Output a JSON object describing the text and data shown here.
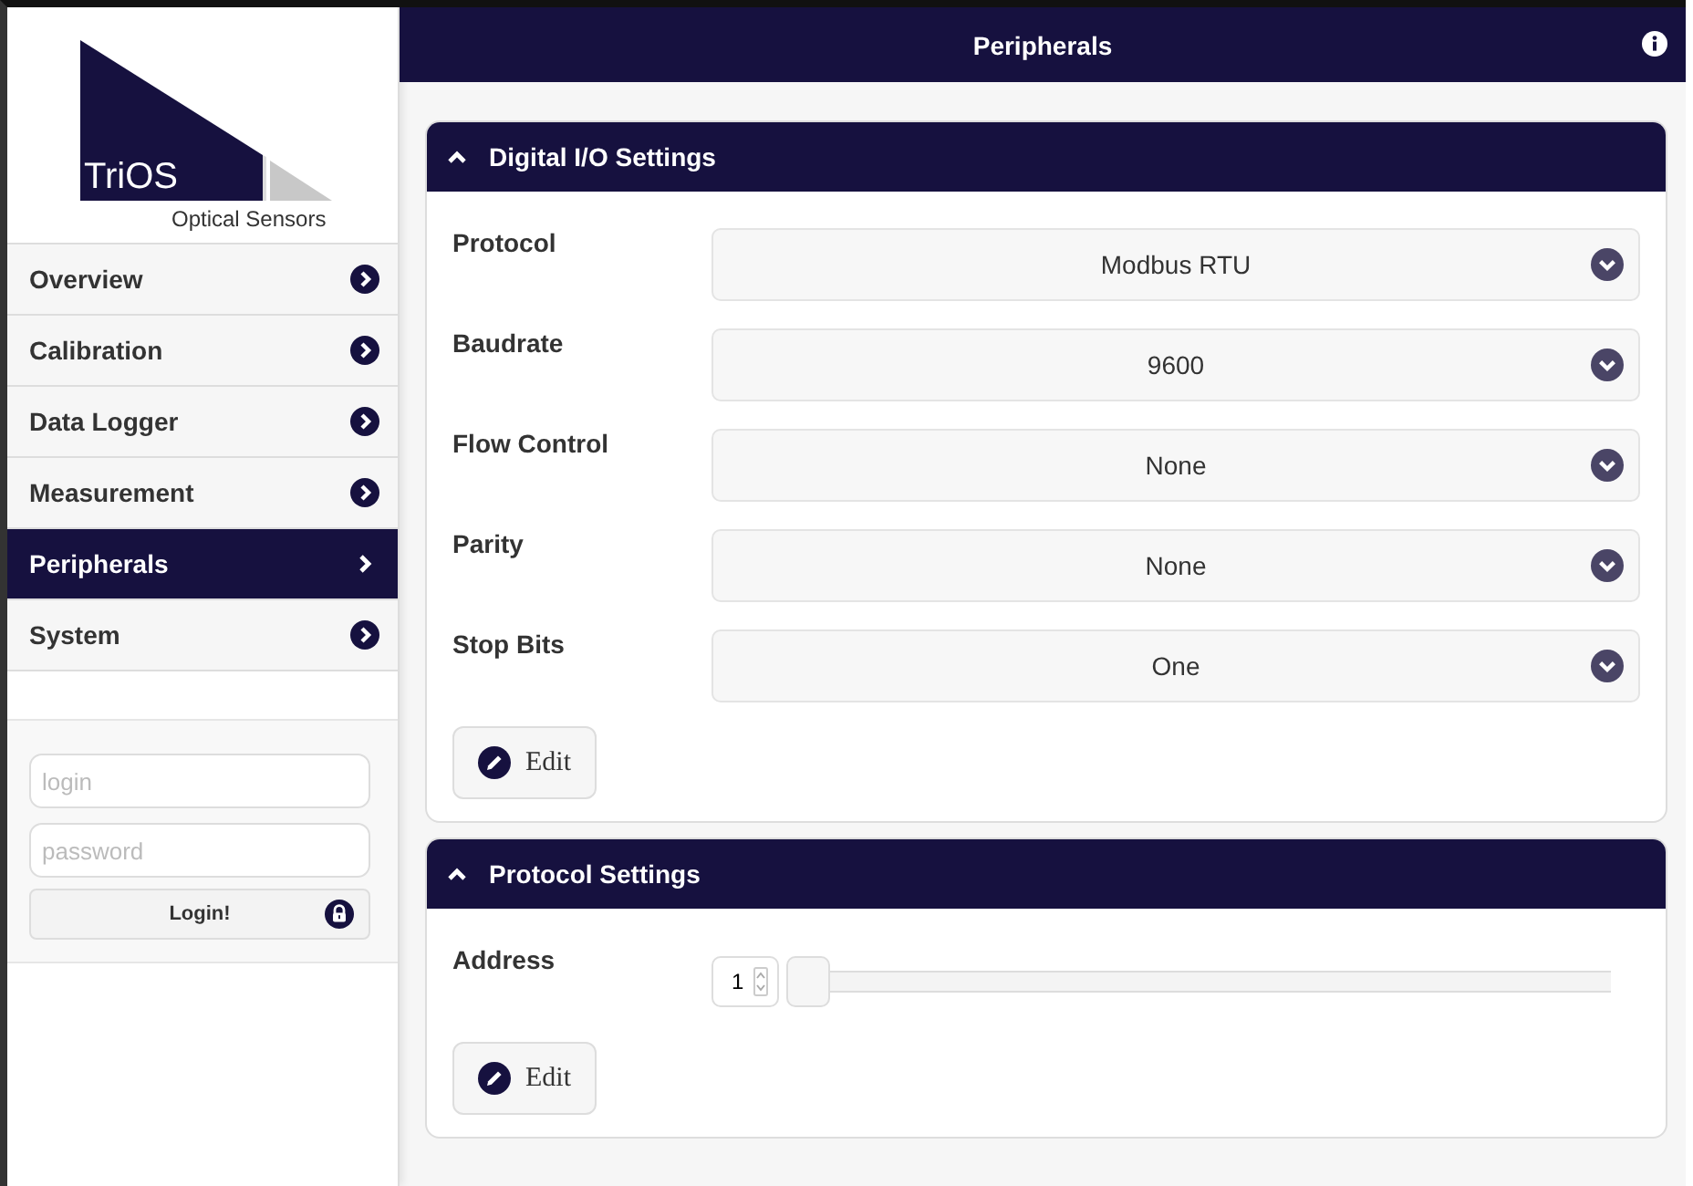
{
  "logo": {
    "brand": "TriOS",
    "tagline": "Optical Sensors"
  },
  "nav": [
    {
      "label": "Overview",
      "selected": false
    },
    {
      "label": "Calibration",
      "selected": false
    },
    {
      "label": "Data Logger",
      "selected": false
    },
    {
      "label": "Measurement",
      "selected": false
    },
    {
      "label": "Peripherals",
      "selected": true
    },
    {
      "label": "System",
      "selected": false
    }
  ],
  "login": {
    "login_placeholder": "login",
    "password_placeholder": "password",
    "button": "Login!"
  },
  "header": {
    "title": "Peripherals"
  },
  "sections": [
    {
      "title": "Digital I/O Settings",
      "expanded": true,
      "fields": [
        {
          "kind": "select",
          "label": "Protocol",
          "value": "Modbus RTU"
        },
        {
          "kind": "select",
          "label": "Baudrate",
          "value": "9600"
        },
        {
          "kind": "select",
          "label": "Flow Control",
          "value": "None"
        },
        {
          "kind": "select",
          "label": "Parity",
          "value": "None"
        },
        {
          "kind": "select",
          "label": "Stop Bits",
          "value": "One"
        }
      ],
      "button": "Edit"
    },
    {
      "title": "Protocol Settings",
      "expanded": true,
      "fields": [
        {
          "kind": "slider",
          "label": "Address",
          "value": "1",
          "level": 0
        }
      ],
      "button": "Edit"
    }
  ]
}
